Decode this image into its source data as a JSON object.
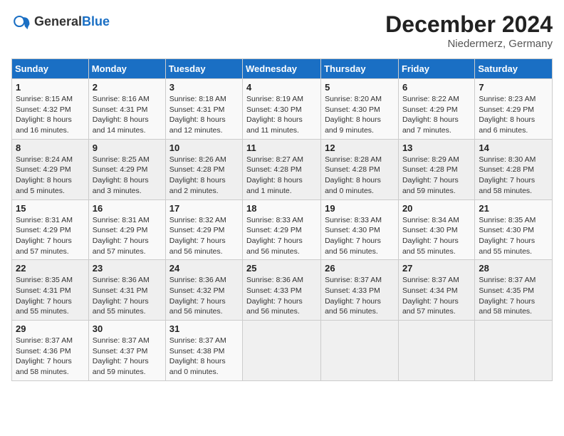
{
  "header": {
    "logo_general": "General",
    "logo_blue": "Blue",
    "month_year": "December 2024",
    "location": "Niedermerz, Germany"
  },
  "calendar": {
    "days_of_week": [
      "Sunday",
      "Monday",
      "Tuesday",
      "Wednesday",
      "Thursday",
      "Friday",
      "Saturday"
    ],
    "weeks": [
      [
        null,
        {
          "day": 2,
          "sunrise": "8:16 AM",
          "sunset": "4:31 PM",
          "daylight": "8 hours and 14 minutes."
        },
        {
          "day": 3,
          "sunrise": "8:18 AM",
          "sunset": "4:31 PM",
          "daylight": "8 hours and 12 minutes."
        },
        {
          "day": 4,
          "sunrise": "8:19 AM",
          "sunset": "4:30 PM",
          "daylight": "8 hours and 11 minutes."
        },
        {
          "day": 5,
          "sunrise": "8:20 AM",
          "sunset": "4:30 PM",
          "daylight": "8 hours and 9 minutes."
        },
        {
          "day": 6,
          "sunrise": "8:22 AM",
          "sunset": "4:29 PM",
          "daylight": "8 hours and 7 minutes."
        },
        {
          "day": 7,
          "sunrise": "8:23 AM",
          "sunset": "4:29 PM",
          "daylight": "8 hours and 6 minutes."
        },
        {
          "day": 1,
          "sunrise": "8:15 AM",
          "sunset": "4:32 PM",
          "daylight": "8 hours and 16 minutes."
        }
      ],
      [
        {
          "day": 8,
          "sunrise": "8:24 AM",
          "sunset": "4:29 PM",
          "daylight": "8 hours and 5 minutes."
        },
        {
          "day": 9,
          "sunrise": "8:25 AM",
          "sunset": "4:29 PM",
          "daylight": "8 hours and 3 minutes."
        },
        {
          "day": 10,
          "sunrise": "8:26 AM",
          "sunset": "4:28 PM",
          "daylight": "8 hours and 2 minutes."
        },
        {
          "day": 11,
          "sunrise": "8:27 AM",
          "sunset": "4:28 PM",
          "daylight": "8 hours and 1 minute."
        },
        {
          "day": 12,
          "sunrise": "8:28 AM",
          "sunset": "4:28 PM",
          "daylight": "8 hours and 0 minutes."
        },
        {
          "day": 13,
          "sunrise": "8:29 AM",
          "sunset": "4:28 PM",
          "daylight": "7 hours and 59 minutes."
        },
        {
          "day": 14,
          "sunrise": "8:30 AM",
          "sunset": "4:28 PM",
          "daylight": "7 hours and 58 minutes."
        }
      ],
      [
        {
          "day": 15,
          "sunrise": "8:31 AM",
          "sunset": "4:29 PM",
          "daylight": "7 hours and 57 minutes."
        },
        {
          "day": 16,
          "sunrise": "8:31 AM",
          "sunset": "4:29 PM",
          "daylight": "7 hours and 57 minutes."
        },
        {
          "day": 17,
          "sunrise": "8:32 AM",
          "sunset": "4:29 PM",
          "daylight": "7 hours and 56 minutes."
        },
        {
          "day": 18,
          "sunrise": "8:33 AM",
          "sunset": "4:29 PM",
          "daylight": "7 hours and 56 minutes."
        },
        {
          "day": 19,
          "sunrise": "8:33 AM",
          "sunset": "4:30 PM",
          "daylight": "7 hours and 56 minutes."
        },
        {
          "day": 20,
          "sunrise": "8:34 AM",
          "sunset": "4:30 PM",
          "daylight": "7 hours and 55 minutes."
        },
        {
          "day": 21,
          "sunrise": "8:35 AM",
          "sunset": "4:30 PM",
          "daylight": "7 hours and 55 minutes."
        }
      ],
      [
        {
          "day": 22,
          "sunrise": "8:35 AM",
          "sunset": "4:31 PM",
          "daylight": "7 hours and 55 minutes."
        },
        {
          "day": 23,
          "sunrise": "8:36 AM",
          "sunset": "4:31 PM",
          "daylight": "7 hours and 55 minutes."
        },
        {
          "day": 24,
          "sunrise": "8:36 AM",
          "sunset": "4:32 PM",
          "daylight": "7 hours and 56 minutes."
        },
        {
          "day": 25,
          "sunrise": "8:36 AM",
          "sunset": "4:33 PM",
          "daylight": "7 hours and 56 minutes."
        },
        {
          "day": 26,
          "sunrise": "8:37 AM",
          "sunset": "4:33 PM",
          "daylight": "7 hours and 56 minutes."
        },
        {
          "day": 27,
          "sunrise": "8:37 AM",
          "sunset": "4:34 PM",
          "daylight": "7 hours and 57 minutes."
        },
        {
          "day": 28,
          "sunrise": "8:37 AM",
          "sunset": "4:35 PM",
          "daylight": "7 hours and 58 minutes."
        }
      ],
      [
        {
          "day": 29,
          "sunrise": "8:37 AM",
          "sunset": "4:36 PM",
          "daylight": "7 hours and 58 minutes."
        },
        {
          "day": 30,
          "sunrise": "8:37 AM",
          "sunset": "4:37 PM",
          "daylight": "7 hours and 59 minutes."
        },
        {
          "day": 31,
          "sunrise": "8:37 AM",
          "sunset": "4:38 PM",
          "daylight": "8 hours and 0 minutes."
        },
        null,
        null,
        null,
        null
      ]
    ],
    "week1_sunday": {
      "day": 1,
      "sunrise": "8:15 AM",
      "sunset": "4:32 PM",
      "daylight": "8 hours and 16 minutes."
    }
  }
}
